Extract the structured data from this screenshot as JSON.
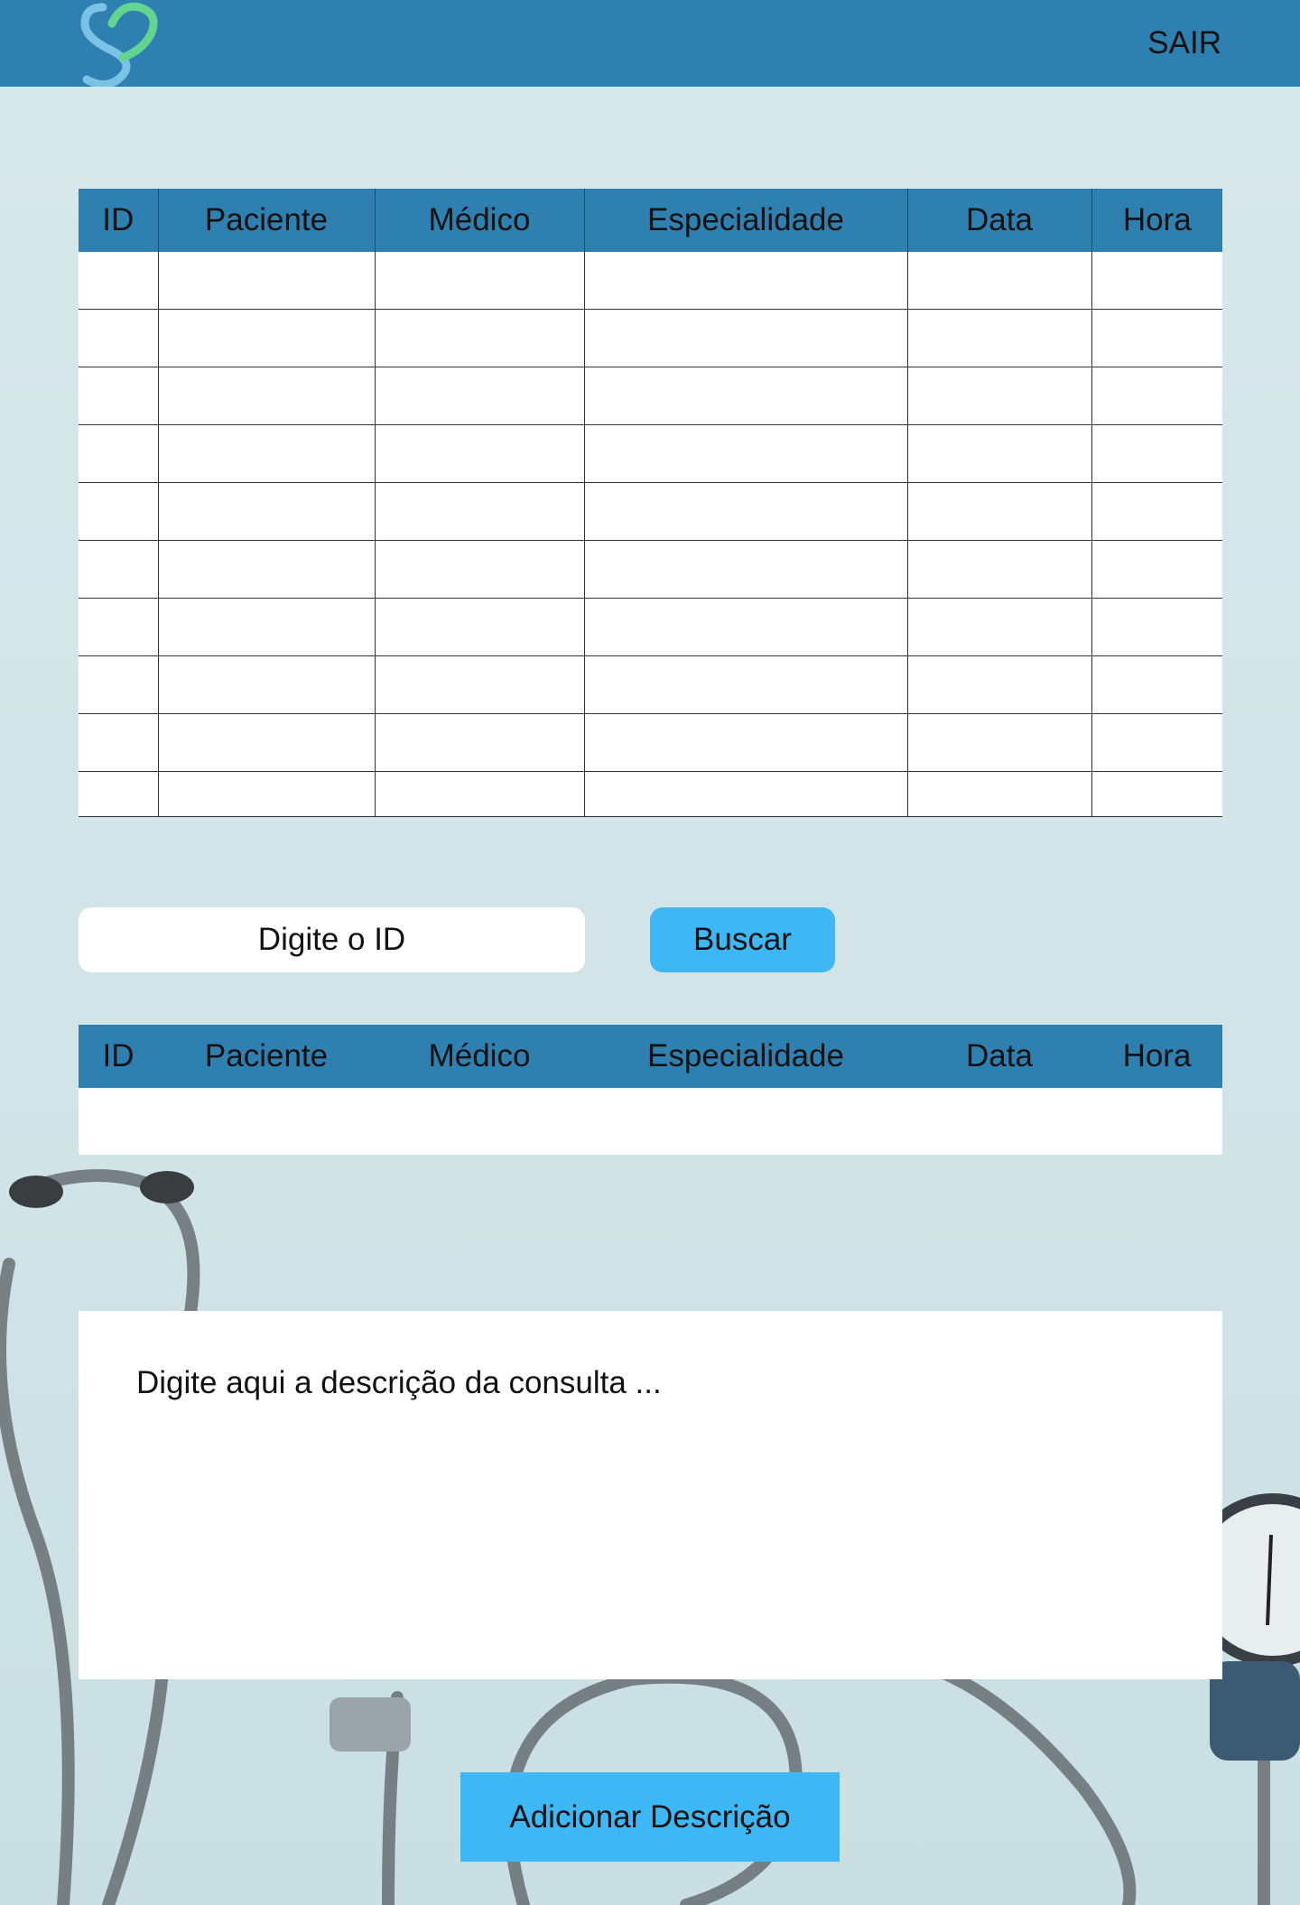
{
  "header": {
    "logout_label": "SAIR",
    "logo_icon": "heart-logo-icon"
  },
  "appointments_table": {
    "columns": [
      "ID",
      "Paciente",
      "Médico",
      "Especialidade",
      "Data",
      "Hora"
    ],
    "rows": [
      [],
      [],
      [],
      [],
      [],
      [],
      [],
      [],
      [],
      []
    ]
  },
  "search": {
    "placeholder": "Digite o ID",
    "value": "",
    "button_label": "Buscar"
  },
  "result_table": {
    "columns": [
      "ID",
      "Paciente",
      "Médico",
      "Especialidade",
      "Data",
      "Hora"
    ],
    "rows": [
      []
    ]
  },
  "description": {
    "placeholder": "Digite aqui a descrição da consulta ...",
    "value": ""
  },
  "add_button_label": "Adicionar Descrição",
  "colors": {
    "header": "#2e80b0",
    "button": "#3eb8f5",
    "background": "#d3e5e8"
  }
}
